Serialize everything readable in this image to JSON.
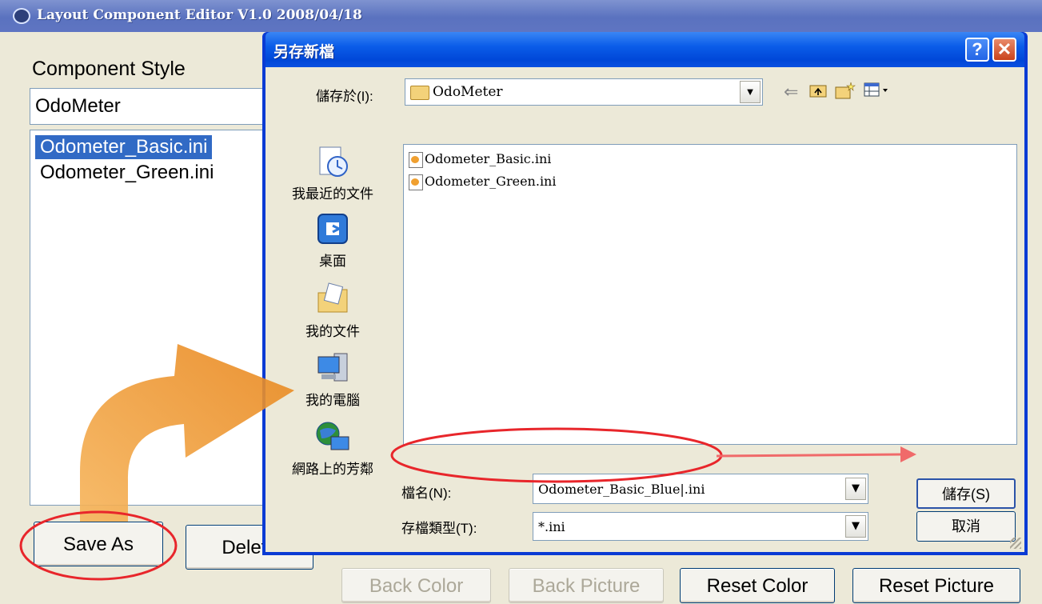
{
  "editor": {
    "title": "Layout Component Editor V1.0  2008/04/18",
    "component_style_label": "Component Style",
    "style_value": "OdoMeter",
    "styles": [
      "Odometer_Basic.ini",
      "Odometer_Green.ini"
    ],
    "selected_style": "Odometer_Basic.ini",
    "buttons": {
      "save_as": "Save As",
      "delete": "Delete",
      "back_color": "Back Color",
      "back_picture": "Back Picture",
      "reset_color": "Reset Color",
      "reset_picture": "Reset Picture"
    }
  },
  "dialog": {
    "title": "另存新檔",
    "save_in_label": "儲存於(I):",
    "save_in_value": "OdoMeter",
    "places": [
      "我最近的文件",
      "桌面",
      "我的文件",
      "我的電腦",
      "網路上的芳鄰"
    ],
    "files": [
      "Odometer_Basic.ini",
      "Odometer_Green.ini"
    ],
    "filename_label": "檔名(N):",
    "filename_value": "Odometer_Basic_Blue|.ini",
    "filetype_label": "存檔類型(T):",
    "filetype_value": "*.ini",
    "save_button": "儲存(S)",
    "cancel_button": "取消",
    "help_glyph": "?",
    "close_glyph": "✕"
  },
  "icons": {
    "back": "back-arrow-icon",
    "up_folder": "up-folder-icon",
    "new_folder": "new-folder-icon",
    "view_menu": "view-menu-icon"
  },
  "colors": {
    "highlight": "#316ac5",
    "annotation_red": "#e8262b",
    "annotation_orange": "#f09a30"
  }
}
